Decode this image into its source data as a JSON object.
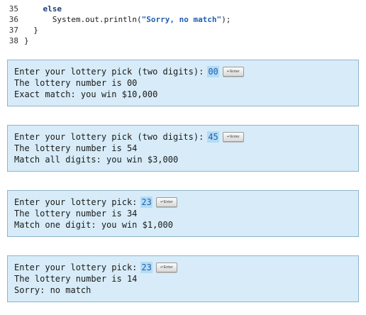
{
  "code": [
    {
      "num": "35",
      "indent": "    ",
      "keyword": "else",
      "text": "",
      "string": "",
      "after": ""
    },
    {
      "num": "36",
      "indent": "      ",
      "keyword": "",
      "text": "System.out.println(",
      "string": "\"Sorry, no match\"",
      "after": ");"
    },
    {
      "num": "37",
      "indent": "  ",
      "keyword": "",
      "text": "}",
      "string": "",
      "after": ""
    },
    {
      "num": "38",
      "indent": "",
      "keyword": "",
      "text": "}",
      "string": "",
      "after": ""
    }
  ],
  "enter_key_label": "Enter",
  "runs": [
    {
      "prompt": "Enter your lottery pick (two digits):",
      "input": "00",
      "lottery_line": "The lottery number is 00",
      "result_line": "Exact match: you win $10,000"
    },
    {
      "prompt": "Enter your lottery pick (two digits):",
      "input": "45",
      "lottery_line": "The lottery number is 54",
      "result_line": "Match all digits: you win $3,000"
    },
    {
      "prompt": "Enter your lottery pick:",
      "input": "23",
      "lottery_line": "The lottery number is 34",
      "result_line": "Match one digit: you win $1,000"
    },
    {
      "prompt": "Enter your lottery pick:",
      "input": "23",
      "lottery_line": "The lottery number is 14",
      "result_line": "Sorry: no match"
    }
  ],
  "colors": {
    "console_background": "#d7ecf8",
    "input_highlight": "#b4dcf5",
    "keyword": "#1f3d7a",
    "string_literal": "#1f5fb0"
  }
}
